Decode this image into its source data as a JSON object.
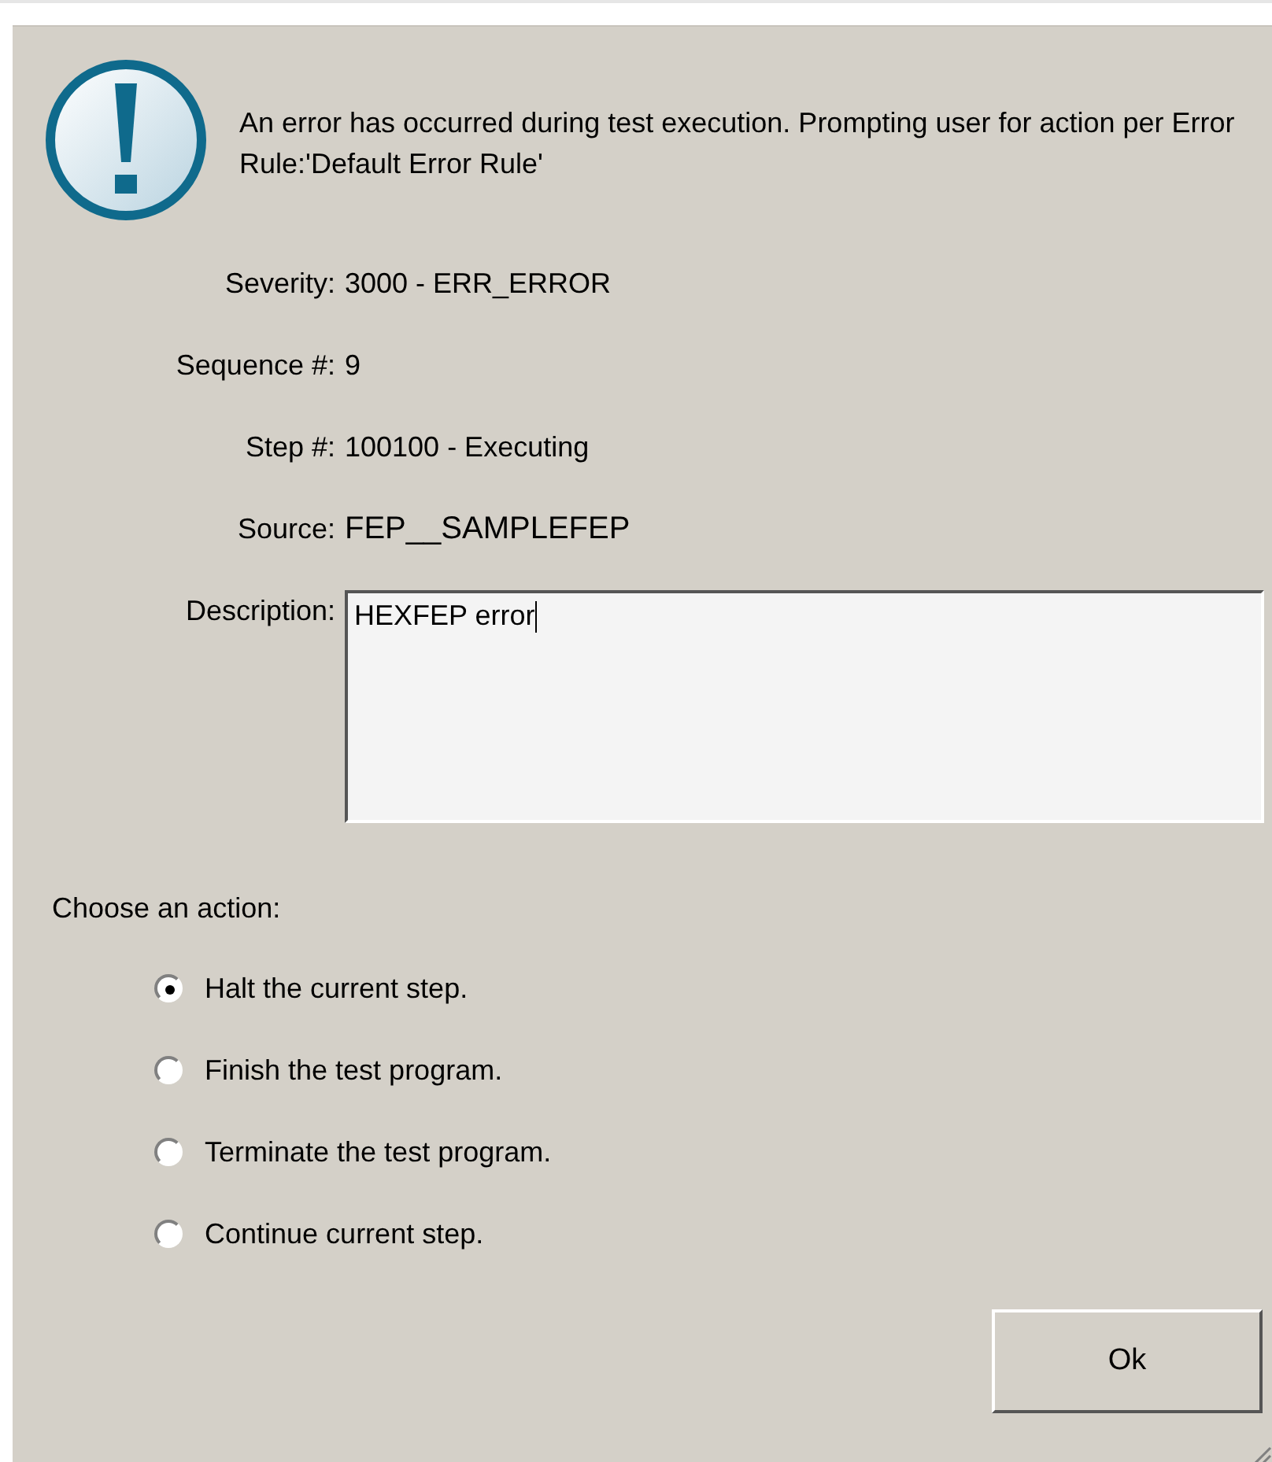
{
  "message": "An error has occurred during test execution. Prompting user for action per Error Rule:'Default Error Rule'",
  "fields": [
    {
      "label": "Severity:",
      "value": "3000 - ERR_ERROR"
    },
    {
      "label": "Sequence #:",
      "value": "9"
    },
    {
      "label": "Step #:",
      "value": "100100 - Executing"
    },
    {
      "label": "Source:",
      "value": "FEP__SAMPLEFEP"
    }
  ],
  "description": {
    "label": "Description:",
    "value": "HEXFEP error"
  },
  "action_prompt": "Choose an action:",
  "actions": [
    {
      "label": "Halt the current step.",
      "selected": true
    },
    {
      "label": "Finish the test program.",
      "selected": false
    },
    {
      "label": "Terminate the test program.",
      "selected": false
    },
    {
      "label": "Continue current step.",
      "selected": false
    }
  ],
  "ok_button": "Ok"
}
